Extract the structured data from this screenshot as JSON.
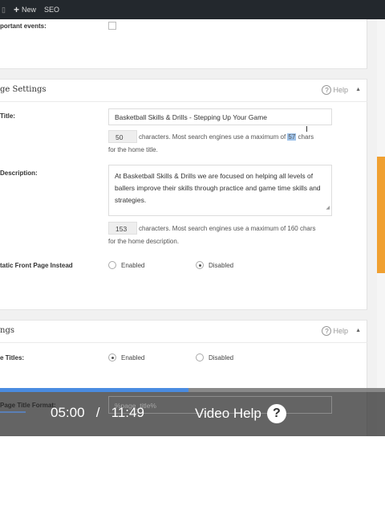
{
  "admin_bar": {
    "new_label": "New",
    "seo_label": "SEO"
  },
  "panel1": {
    "important_events_label": "portant events:"
  },
  "home_settings": {
    "title": "ge Settings",
    "help_label": "Help",
    "title_label": "Title:",
    "title_value": "Basketball Skills & Drills - Stepping Up Your Game",
    "title_count": "50",
    "title_note_line1_a": "characters. Most search engines use a maximum of ",
    "title_note_line1_hl": "57",
    "title_note_line1_b": " chars",
    "title_note_line2": "for the home title.",
    "desc_label": "Description:",
    "desc_value": "At Basketball Skills & Drills we are focused on helping all levels of ballers improve their skills through practice and game time skills and strategies.",
    "desc_count": "153",
    "desc_note_line1": "characters. Most search engines use a maximum of 160 chars",
    "desc_note_line2": "for the home description.",
    "static_label": "tatic Front Page Instead",
    "enabled_label": "Enabled",
    "disabled_label": "Disabled"
  },
  "title_settings": {
    "title": "ngs",
    "help_label": "Help",
    "rewrite_label": "e Titles:",
    "enabled_label": "Enabled",
    "disabled_label": "Disabled",
    "page_title_format_label": "Page Title Format:",
    "page_title_format_value": "%page_title%"
  },
  "player": {
    "current_time": "05:00",
    "separator": "/",
    "duration": "11:49",
    "video_help_label": "Video Help",
    "help_glyph": "?",
    "progress_fraction": 0.49
  }
}
